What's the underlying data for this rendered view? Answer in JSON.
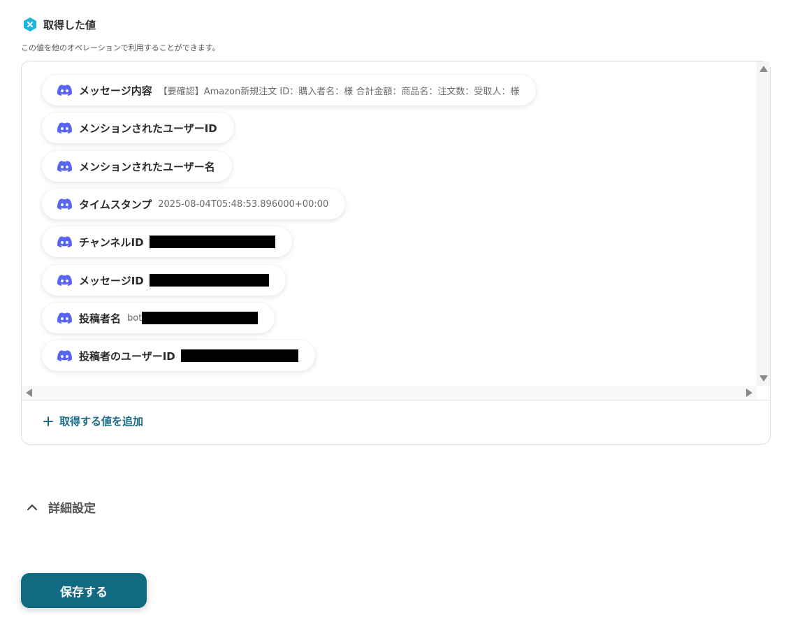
{
  "header": {
    "title": "取得した値",
    "subtitle": "この値を他のオペレーションで利用することができます。"
  },
  "values": [
    {
      "label": "メッセージ内容",
      "value": "【要確認】Amazon新規注文 ID：購入者名：様 合計金額：商品名：注文数：受取人：様",
      "redacted": false
    },
    {
      "label": "メンションされたユーザーID",
      "value": "",
      "redacted": false
    },
    {
      "label": "メンションされたユーザー名",
      "value": "",
      "redacted": false
    },
    {
      "label": "タイムスタンプ",
      "value": "2025-08-04T05:48:53.896000+00:00",
      "redacted": false
    },
    {
      "label": "チャンネルID",
      "value": "",
      "redacted": true
    },
    {
      "label": "メッセージID",
      "value": "",
      "redacted": true
    },
    {
      "label": "投稿者名",
      "value": "bot",
      "redacted": true
    },
    {
      "label": "投稿者のユーザーID",
      "value": "",
      "redacted": true
    }
  ],
  "add_button": {
    "label": "取得する値を追加"
  },
  "advanced": {
    "label": "詳細設定",
    "expanded": true
  },
  "save_button": {
    "label": "保存する"
  },
  "icons": {
    "header": "yoom-hex-icon",
    "value_item": "discord-icon",
    "add": "plus-icon",
    "advanced_toggle": "chevron-up-icon"
  },
  "colors": {
    "discord": "#5865f2",
    "accent": "#1c6a84",
    "save_button": "#0f6a82",
    "header_hex": "#1bb5dd"
  }
}
